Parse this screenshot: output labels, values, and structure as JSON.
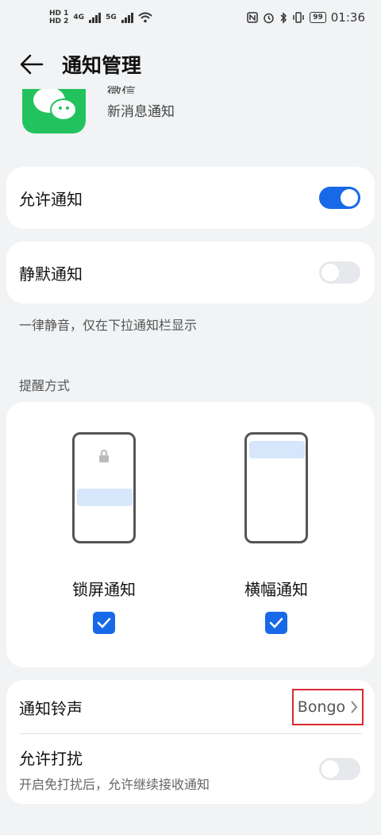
{
  "status_bar": {
    "hd1": "HD 1",
    "hd2": "HD 2",
    "net1": "4G",
    "net2": "5G",
    "battery": "99",
    "time": "01:36"
  },
  "header": {
    "title": "通知管理"
  },
  "app": {
    "name": "微信",
    "subtitle": "新消息通知"
  },
  "allow_notifications": {
    "label": "允许通知",
    "state": "on"
  },
  "silent_notifications": {
    "label": "静默通知",
    "state": "off",
    "hint": "一律静音，仅在下拉通知栏显示"
  },
  "reminder_section": {
    "title": "提醒方式",
    "options": [
      {
        "label": "锁屏通知",
        "checked": true
      },
      {
        "label": "横幅通知",
        "checked": true
      }
    ]
  },
  "ringtone": {
    "label": "通知铃声",
    "value": "Bongo"
  },
  "dnd": {
    "label": "允许打扰",
    "subtitle": "开启免打扰后，允许继续接收通知",
    "state": "off"
  },
  "colors": {
    "accent": "#1769e8",
    "wechat_green": "#22c35e",
    "highlight": "#d9282f"
  }
}
